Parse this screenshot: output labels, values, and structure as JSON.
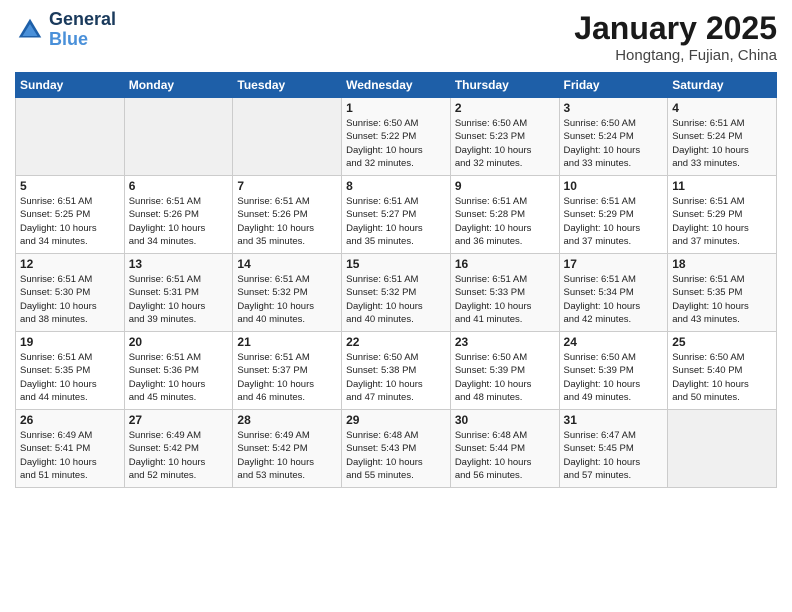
{
  "header": {
    "logo_line1": "General",
    "logo_line2": "Blue",
    "month_title": "January 2025",
    "location": "Hongtang, Fujian, China"
  },
  "days_of_week": [
    "Sunday",
    "Monday",
    "Tuesday",
    "Wednesday",
    "Thursday",
    "Friday",
    "Saturday"
  ],
  "weeks": [
    [
      {
        "day": "",
        "info": ""
      },
      {
        "day": "",
        "info": ""
      },
      {
        "day": "",
        "info": ""
      },
      {
        "day": "1",
        "info": "Sunrise: 6:50 AM\nSunset: 5:22 PM\nDaylight: 10 hours\nand 32 minutes."
      },
      {
        "day": "2",
        "info": "Sunrise: 6:50 AM\nSunset: 5:23 PM\nDaylight: 10 hours\nand 32 minutes."
      },
      {
        "day": "3",
        "info": "Sunrise: 6:50 AM\nSunset: 5:24 PM\nDaylight: 10 hours\nand 33 minutes."
      },
      {
        "day": "4",
        "info": "Sunrise: 6:51 AM\nSunset: 5:24 PM\nDaylight: 10 hours\nand 33 minutes."
      }
    ],
    [
      {
        "day": "5",
        "info": "Sunrise: 6:51 AM\nSunset: 5:25 PM\nDaylight: 10 hours\nand 34 minutes."
      },
      {
        "day": "6",
        "info": "Sunrise: 6:51 AM\nSunset: 5:26 PM\nDaylight: 10 hours\nand 34 minutes."
      },
      {
        "day": "7",
        "info": "Sunrise: 6:51 AM\nSunset: 5:26 PM\nDaylight: 10 hours\nand 35 minutes."
      },
      {
        "day": "8",
        "info": "Sunrise: 6:51 AM\nSunset: 5:27 PM\nDaylight: 10 hours\nand 35 minutes."
      },
      {
        "day": "9",
        "info": "Sunrise: 6:51 AM\nSunset: 5:28 PM\nDaylight: 10 hours\nand 36 minutes."
      },
      {
        "day": "10",
        "info": "Sunrise: 6:51 AM\nSunset: 5:29 PM\nDaylight: 10 hours\nand 37 minutes."
      },
      {
        "day": "11",
        "info": "Sunrise: 6:51 AM\nSunset: 5:29 PM\nDaylight: 10 hours\nand 37 minutes."
      }
    ],
    [
      {
        "day": "12",
        "info": "Sunrise: 6:51 AM\nSunset: 5:30 PM\nDaylight: 10 hours\nand 38 minutes."
      },
      {
        "day": "13",
        "info": "Sunrise: 6:51 AM\nSunset: 5:31 PM\nDaylight: 10 hours\nand 39 minutes."
      },
      {
        "day": "14",
        "info": "Sunrise: 6:51 AM\nSunset: 5:32 PM\nDaylight: 10 hours\nand 40 minutes."
      },
      {
        "day": "15",
        "info": "Sunrise: 6:51 AM\nSunset: 5:32 PM\nDaylight: 10 hours\nand 40 minutes."
      },
      {
        "day": "16",
        "info": "Sunrise: 6:51 AM\nSunset: 5:33 PM\nDaylight: 10 hours\nand 41 minutes."
      },
      {
        "day": "17",
        "info": "Sunrise: 6:51 AM\nSunset: 5:34 PM\nDaylight: 10 hours\nand 42 minutes."
      },
      {
        "day": "18",
        "info": "Sunrise: 6:51 AM\nSunset: 5:35 PM\nDaylight: 10 hours\nand 43 minutes."
      }
    ],
    [
      {
        "day": "19",
        "info": "Sunrise: 6:51 AM\nSunset: 5:35 PM\nDaylight: 10 hours\nand 44 minutes."
      },
      {
        "day": "20",
        "info": "Sunrise: 6:51 AM\nSunset: 5:36 PM\nDaylight: 10 hours\nand 45 minutes."
      },
      {
        "day": "21",
        "info": "Sunrise: 6:51 AM\nSunset: 5:37 PM\nDaylight: 10 hours\nand 46 minutes."
      },
      {
        "day": "22",
        "info": "Sunrise: 6:50 AM\nSunset: 5:38 PM\nDaylight: 10 hours\nand 47 minutes."
      },
      {
        "day": "23",
        "info": "Sunrise: 6:50 AM\nSunset: 5:39 PM\nDaylight: 10 hours\nand 48 minutes."
      },
      {
        "day": "24",
        "info": "Sunrise: 6:50 AM\nSunset: 5:39 PM\nDaylight: 10 hours\nand 49 minutes."
      },
      {
        "day": "25",
        "info": "Sunrise: 6:50 AM\nSunset: 5:40 PM\nDaylight: 10 hours\nand 50 minutes."
      }
    ],
    [
      {
        "day": "26",
        "info": "Sunrise: 6:49 AM\nSunset: 5:41 PM\nDaylight: 10 hours\nand 51 minutes."
      },
      {
        "day": "27",
        "info": "Sunrise: 6:49 AM\nSunset: 5:42 PM\nDaylight: 10 hours\nand 52 minutes."
      },
      {
        "day": "28",
        "info": "Sunrise: 6:49 AM\nSunset: 5:42 PM\nDaylight: 10 hours\nand 53 minutes."
      },
      {
        "day": "29",
        "info": "Sunrise: 6:48 AM\nSunset: 5:43 PM\nDaylight: 10 hours\nand 55 minutes."
      },
      {
        "day": "30",
        "info": "Sunrise: 6:48 AM\nSunset: 5:44 PM\nDaylight: 10 hours\nand 56 minutes."
      },
      {
        "day": "31",
        "info": "Sunrise: 6:47 AM\nSunset: 5:45 PM\nDaylight: 10 hours\nand 57 minutes."
      },
      {
        "day": "",
        "info": ""
      }
    ]
  ]
}
